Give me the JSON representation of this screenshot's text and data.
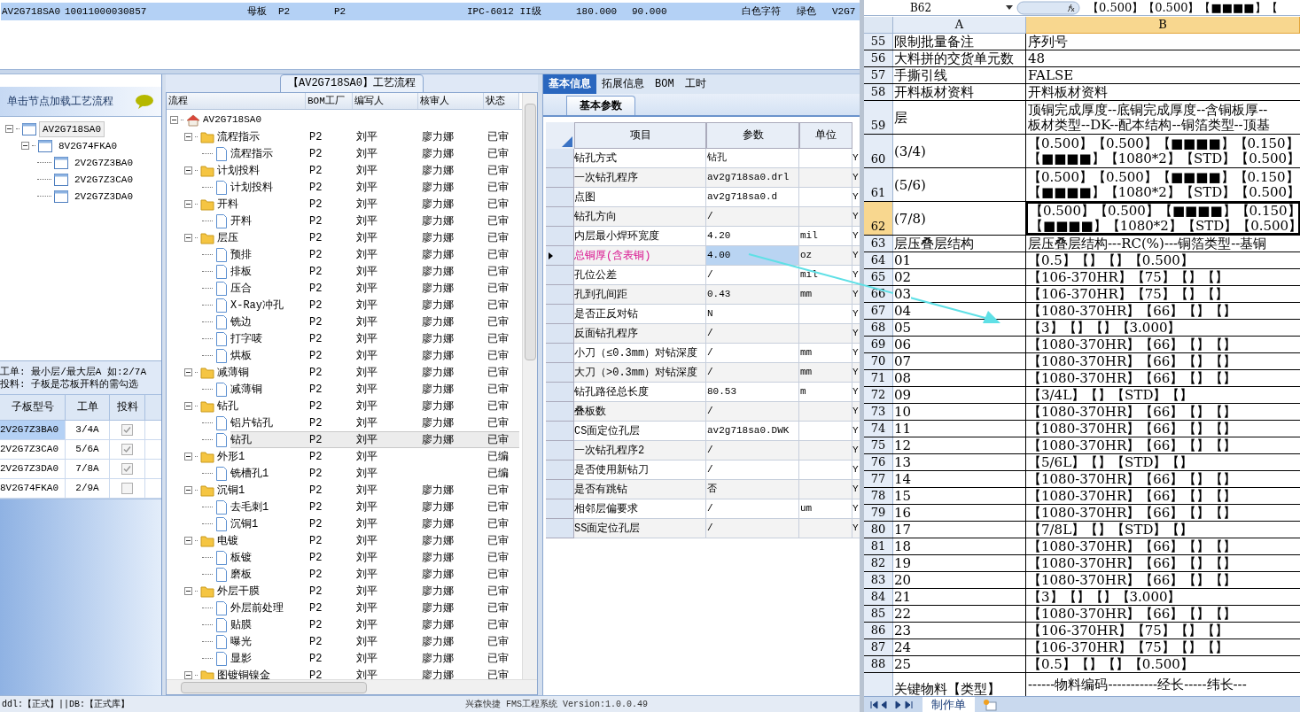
{
  "top_grid": {
    "row": {
      "selected": true,
      "cells": [
        "AV2G718SA0",
        "10011000030857",
        "母板",
        "P2",
        "P2",
        "IPC-6012 II级",
        "180.000",
        "90.000",
        "白色字符",
        "绿色",
        "V2G7"
      ]
    }
  },
  "left_panel": {
    "header": "单击节点加载工艺流程",
    "tree": [
      {
        "name": "AV2G718SA0",
        "selected": true,
        "expanded": true,
        "children": [
          {
            "name": "8V2G74FKA0",
            "selected": false,
            "expanded": true,
            "children": [
              {
                "name": "2V2G7Z3BA0",
                "selected": false
              },
              {
                "name": "2V2G7Z3CA0",
                "selected": false
              },
              {
                "name": "2V2G7Z3DA0",
                "selected": false
              }
            ]
          }
        ]
      }
    ],
    "notes": [
      "工单: 最小层/最大层A 如:2/7A",
      "投料: 子板是芯板开料的需勾选"
    ],
    "table": {
      "columns": [
        "子板型号",
        "工单",
        "投料"
      ],
      "rows": [
        {
          "model": "2V2G7Z3BA0",
          "order": "3/4A",
          "checked": true,
          "selected": true
        },
        {
          "model": "2V2G7Z3CA0",
          "order": "5/6A",
          "checked": true,
          "selected": false
        },
        {
          "model": "2V2G7Z3DA0",
          "order": "7/8A",
          "checked": true,
          "selected": false
        },
        {
          "model": "8V2G74FKA0",
          "order": "2/9A",
          "checked": false,
          "selected": false
        }
      ]
    }
  },
  "flow": {
    "title": "【AV2G718SA0】工艺流程",
    "columns": [
      "流程",
      "BOM工厂",
      "编写人",
      "核审人",
      "状态"
    ],
    "root": {
      "name": "AV2G718SA0",
      "expanded": true,
      "children": [
        {
          "name": "流程指示",
          "bom": "P2",
          "writer": "刘平",
          "reviewer": "廖力娜",
          "status": "已审",
          "selected": false,
          "expanded": true,
          "children": [
            {
              "name": "流程指示",
              "bom": "P2",
              "writer": "刘平",
              "reviewer": "廖力娜",
              "status": "已审",
              "selected": false
            }
          ]
        },
        {
          "name": "计划投料",
          "bom": "P2",
          "writer": "刘平",
          "reviewer": "廖力娜",
          "status": "已审",
          "selected": false,
          "expanded": true,
          "children": [
            {
              "name": "计划投料",
              "bom": "P2",
              "writer": "刘平",
              "reviewer": "廖力娜",
              "status": "已审",
              "selected": false
            }
          ]
        },
        {
          "name": "开料",
          "bom": "P2",
          "writer": "刘平",
          "reviewer": "廖力娜",
          "status": "已审",
          "selected": false,
          "expanded": true,
          "children": [
            {
              "name": "开料",
              "bom": "P2",
              "writer": "刘平",
              "reviewer": "廖力娜",
              "status": "已审",
              "selected": false
            }
          ]
        },
        {
          "name": "层压",
          "bom": "P2",
          "writer": "刘平",
          "reviewer": "廖力娜",
          "status": "已审",
          "selected": false,
          "expanded": true,
          "children": [
            {
              "name": "预排",
              "bom": "P2",
              "writer": "刘平",
              "reviewer": "廖力娜",
              "status": "已审",
              "selected": false
            },
            {
              "name": "排板",
              "bom": "P2",
              "writer": "刘平",
              "reviewer": "廖力娜",
              "status": "已审",
              "selected": false
            },
            {
              "name": "压合",
              "bom": "P2",
              "writer": "刘平",
              "reviewer": "廖力娜",
              "status": "已审",
              "selected": false
            },
            {
              "name": "X-Ray冲孔",
              "bom": "P2",
              "writer": "刘平",
              "reviewer": "廖力娜",
              "status": "已审",
              "selected": false
            },
            {
              "name": "铣边",
              "bom": "P2",
              "writer": "刘平",
              "reviewer": "廖力娜",
              "status": "已审",
              "selected": false
            },
            {
              "name": "打字唛",
              "bom": "P2",
              "writer": "刘平",
              "reviewer": "廖力娜",
              "status": "已审",
              "selected": false
            },
            {
              "name": "烘板",
              "bom": "P2",
              "writer": "刘平",
              "reviewer": "廖力娜",
              "status": "已审",
              "selected": false
            }
          ]
        },
        {
          "name": "减薄铜",
          "bom": "P2",
          "writer": "刘平",
          "reviewer": "廖力娜",
          "status": "已审",
          "selected": false,
          "expanded": true,
          "children": [
            {
              "name": "减薄铜",
              "bom": "P2",
              "writer": "刘平",
              "reviewer": "廖力娜",
              "status": "已审",
              "selected": false
            }
          ]
        },
        {
          "name": "钻孔",
          "bom": "P2",
          "writer": "刘平",
          "reviewer": "廖力娜",
          "status": "已审",
          "selected": false,
          "expanded": true,
          "children": [
            {
              "name": "铝片钻孔",
              "bom": "P2",
              "writer": "刘平",
              "reviewer": "廖力娜",
              "status": "已审",
              "selected": false
            },
            {
              "name": "钻孔",
              "bom": "P2",
              "writer": "刘平",
              "reviewer": "廖力娜",
              "status": "已审",
              "selected": true
            }
          ]
        },
        {
          "name": "外形1",
          "bom": "P2",
          "writer": "刘平",
          "status": "已编",
          "selected": false,
          "expanded": true,
          "children": [
            {
              "name": "铣槽孔1",
              "bom": "P2",
              "writer": "刘平",
              "status": "已编",
              "selected": false
            }
          ]
        },
        {
          "name": "沉铜1",
          "bom": "P2",
          "writer": "刘平",
          "reviewer": "廖力娜",
          "status": "已审",
          "selected": false,
          "expanded": true,
          "children": [
            {
              "name": "去毛刺1",
              "bom": "P2",
              "writer": "刘平",
              "reviewer": "廖力娜",
              "status": "已审",
              "selected": false
            },
            {
              "name": "沉铜1",
              "bom": "P2",
              "writer": "刘平",
              "reviewer": "廖力娜",
              "status": "已审",
              "selected": false
            }
          ]
        },
        {
          "name": "电镀",
          "bom": "P2",
          "writer": "刘平",
          "reviewer": "廖力娜",
          "status": "已审",
          "selected": false,
          "expanded": true,
          "children": [
            {
              "name": "板镀",
              "bom": "P2",
              "writer": "刘平",
              "reviewer": "廖力娜",
              "status": "已审",
              "selected": false
            },
            {
              "name": "磨板",
              "bom": "P2",
              "writer": "刘平",
              "reviewer": "廖力娜",
              "status": "已审",
              "selected": false
            }
          ]
        },
        {
          "name": "外层干膜",
          "bom": "P2",
          "writer": "刘平",
          "reviewer": "廖力娜",
          "status": "已审",
          "selected": false,
          "expanded": true,
          "children": [
            {
              "name": "外层前处理",
              "bom": "P2",
              "writer": "刘平",
              "reviewer": "廖力娜",
              "status": "已审",
              "selected": false
            },
            {
              "name": "贴膜",
              "bom": "P2",
              "writer": "刘平",
              "reviewer": "廖力娜",
              "status": "已审",
              "selected": false
            },
            {
              "name": "曝光",
              "bom": "P2",
              "writer": "刘平",
              "reviewer": "廖力娜",
              "status": "已审",
              "selected": false
            },
            {
              "name": "显影",
              "bom": "P2",
              "writer": "刘平",
              "reviewer": "廖力娜",
              "status": "已审",
              "selected": false
            }
          ]
        },
        {
          "name": "图镀铜镍金",
          "bom": "P2",
          "writer": "刘平",
          "reviewer": "廖力娜",
          "status": "已审",
          "selected": false,
          "expanded": true
        }
      ]
    }
  },
  "details": {
    "tabs": [
      {
        "label": "基本信息",
        "selected": true
      },
      {
        "label": "拓展信息",
        "selected": false
      },
      {
        "label": "BOM",
        "selected": false
      },
      {
        "label": "工时",
        "selected": false
      }
    ],
    "subtab": "基本参数",
    "columns": [
      "项目",
      "参数",
      "单位"
    ],
    "rows": [
      {
        "item": "钻孔方式",
        "value": "钻孔",
        "column_4": "Y",
        "current": false
      },
      {
        "item": "一次钻孔程序",
        "value": "av2g718sa0.drl",
        "column_4": "Y",
        "current": false
      },
      {
        "item": "点图",
        "value": "av2g718sa0.d",
        "column_4": "Y",
        "current": false
      },
      {
        "item": "钻孔方向",
        "value": "/",
        "column_4": "Y",
        "current": false
      },
      {
        "item": "内层最小焊环宽度",
        "value": "4.20",
        "unit": "mil",
        "column_4": "Y",
        "current": false
      },
      {
        "item": "总铜厚(含表铜)",
        "value": "4.00",
        "unit": "oz",
        "column_4": "Y",
        "current": true
      },
      {
        "item": "孔位公差",
        "value": "/",
        "unit": "mil",
        "column_4": "Y",
        "current": false
      },
      {
        "item": "孔到孔间距",
        "value": "0.43",
        "unit": "mm",
        "column_4": "Y",
        "current": false
      },
      {
        "item": "是否正反对钻",
        "value": "N",
        "column_4": "Y",
        "current": false
      },
      {
        "item": "反面钻孔程序",
        "value": "/",
        "column_4": "Y",
        "current": false
      },
      {
        "item": "小刀（≤0.3mm）对钻深度",
        "value": "/",
        "unit": "mm",
        "column_4": "Y",
        "current": false
      },
      {
        "item": "大刀（>0.3mm）对钻深度",
        "value": "/",
        "unit": "mm",
        "column_4": "Y",
        "current": false
      },
      {
        "item": "钻孔路径总长度",
        "value": "80.53",
        "unit": "m",
        "column_4": "Y",
        "current": false
      },
      {
        "item": "叠板数",
        "value": "/",
        "column_4": "Y",
        "current": false
      },
      {
        "item": "CS面定位孔层",
        "value": "av2g718sa0.DWK",
        "column_4": "Y",
        "current": false
      },
      {
        "item": "一次钻孔程序2",
        "value": "/",
        "column_4": "Y",
        "current": false
      },
      {
        "item": "是否使用新钻刀",
        "value": "/",
        "column_4": "Y",
        "current": false
      },
      {
        "item": "是否有跳钻",
        "value": "否",
        "column_4": "Y",
        "current": false
      },
      {
        "item": "相邻层偏要求",
        "value": "/",
        "unit": "um",
        "column_4": "Y",
        "current": false
      },
      {
        "item": "SS面定位孔层",
        "value": "/",
        "column_4": "Y",
        "current": false
      }
    ]
  },
  "status_bar": {
    "left": "ddl:【正式】||DB:【正式库】",
    "center": "兴森快捷 FMS工程系统 Version:1.0.0.49"
  },
  "spreadsheet": {
    "name_box": "B62",
    "formula": "【0.500】【0.500】【■■■■】【",
    "columns": [
      {
        "label": "A",
        "selected": false
      },
      {
        "label": "B",
        "selected": true
      }
    ],
    "rows": [
      {
        "num": "55",
        "a": "限制批量备注",
        "b": [
          "序列号"
        ],
        "flag": false,
        "selected": false
      },
      {
        "num": "56",
        "a": "大料拼的交货单元数",
        "b": [
          "48"
        ],
        "flag": false,
        "selected": false
      },
      {
        "num": "57",
        "a": "手撕引线",
        "b": [
          "FALSE"
        ],
        "flag": false,
        "selected": false
      },
      {
        "num": "58",
        "a": "开料板材资料",
        "b": [
          "开料板材资料"
        ],
        "flag": false,
        "selected": false
      },
      {
        "num": "59",
        "a": "层",
        "b": [
          "顶铜完成厚度--底铜完成厚度--含铜板厚--",
          "板材类型--DK--配本结构--铜箔类型--顶基"
        ],
        "flag": false,
        "selected": false
      },
      {
        "num": "60",
        "a": "(3/4)",
        "b": [
          "【0.500】【0.500】【■■■■】【0.150】",
          "【■■■■】【1080*2】【STD】【0.500】"
        ],
        "flag": false,
        "selected": false
      },
      {
        "num": "61",
        "a": "(5/6)",
        "b": [
          "【0.500】【0.500】【■■■■】【0.150】",
          "【■■■■】【1080*2】【STD】【0.500】"
        ],
        "flag": false,
        "selected": false
      },
      {
        "num": "62",
        "a": "(7/8)",
        "b": [
          "【0.500】【0.500】【■■■■】【0.150】",
          "【■■■■】【1080*2】【STD】【0.500】"
        ],
        "flag": false,
        "selected": true
      },
      {
        "num": "63",
        "a": "层压叠层结构",
        "b": [
          "层压叠层结构---RC(%)---铜箔类型--基铜"
        ],
        "flag": false,
        "selected": false
      },
      {
        "num": "64",
        "a": "01",
        "b": [
          "【0.5】【】【】【0.500】"
        ],
        "flag": true,
        "selected": false
      },
      {
        "num": "65",
        "a": "02",
        "b": [
          "【106-370HR】【75】【】【】"
        ],
        "flag": true,
        "selected": false
      },
      {
        "num": "66",
        "a": "03",
        "b": [
          "【106-370HR】【75】【】【】"
        ],
        "flag": true,
        "selected": false
      },
      {
        "num": "67",
        "a": "04",
        "b": [
          "【1080-370HR】【66】【】【】"
        ],
        "flag": true,
        "selected": false
      },
      {
        "num": "68",
        "a": "05",
        "b": [
          "【3】【】【】【3.000】"
        ],
        "flag": true,
        "selected": false
      },
      {
        "num": "69",
        "a": "06",
        "b": [
          "【1080-370HR】【66】【】【】"
        ],
        "flag": true,
        "selected": false
      },
      {
        "num": "70",
        "a": "07",
        "b": [
          "【1080-370HR】【66】【】【】"
        ],
        "flag": true,
        "selected": false
      },
      {
        "num": "71",
        "a": "08",
        "b": [
          "【1080-370HR】【66】【】【】"
        ],
        "flag": true,
        "selected": false
      },
      {
        "num": "72",
        "a": "09",
        "b": [
          "【3/4L】【】【STD】【】"
        ],
        "flag": true,
        "selected": false
      },
      {
        "num": "73",
        "a": "10",
        "b": [
          "【1080-370HR】【66】【】【】"
        ],
        "flag": true,
        "selected": false
      },
      {
        "num": "74",
        "a": "11",
        "b": [
          "【1080-370HR】【66】【】【】"
        ],
        "flag": true,
        "selected": false
      },
      {
        "num": "75",
        "a": "12",
        "b": [
          "【1080-370HR】【66】【】【】"
        ],
        "flag": true,
        "selected": false
      },
      {
        "num": "76",
        "a": "13",
        "b": [
          "【5/6L】【】【STD】【】"
        ],
        "flag": true,
        "selected": false
      },
      {
        "num": "77",
        "a": "14",
        "b": [
          "【1080-370HR】【66】【】【】"
        ],
        "flag": true,
        "selected": false
      },
      {
        "num": "78",
        "a": "15",
        "b": [
          "【1080-370HR】【66】【】【】"
        ],
        "flag": true,
        "selected": false
      },
      {
        "num": "79",
        "a": "16",
        "b": [
          "【1080-370HR】【66】【】【】"
        ],
        "flag": true,
        "selected": false
      },
      {
        "num": "80",
        "a": "17",
        "b": [
          "【7/8L】【】【STD】【】"
        ],
        "flag": true,
        "selected": false
      },
      {
        "num": "81",
        "a": "18",
        "b": [
          "【1080-370HR】【66】【】【】"
        ],
        "flag": true,
        "selected": false
      },
      {
        "num": "82",
        "a": "19",
        "b": [
          "【1080-370HR】【66】【】【】"
        ],
        "flag": true,
        "selected": false
      },
      {
        "num": "83",
        "a": "20",
        "b": [
          "【1080-370HR】【66】【】【】"
        ],
        "flag": true,
        "selected": false
      },
      {
        "num": "84",
        "a": "21",
        "b": [
          "【3】【】【】【3.000】"
        ],
        "flag": true,
        "selected": false
      },
      {
        "num": "85",
        "a": "22",
        "b": [
          "【1080-370HR】【66】【】【】"
        ],
        "flag": true,
        "selected": false
      },
      {
        "num": "86",
        "a": "23",
        "b": [
          "【106-370HR】【75】【】【】"
        ],
        "flag": true,
        "selected": false
      },
      {
        "num": "87",
        "a": "24",
        "b": [
          "【106-370HR】【75】【】【】"
        ],
        "flag": true,
        "selected": false
      },
      {
        "num": "88",
        "a": "25",
        "b": [
          "【0.5】【】【】【0.500】"
        ],
        "flag": true,
        "selected": false
      },
      {
        "a": "关键物料【类型】",
        "b": [
          "------物料编码-----------经长-----纬长---"
        ]
      }
    ],
    "sheets": [
      {
        "label": "制作单",
        "selected": true
      }
    ]
  }
}
